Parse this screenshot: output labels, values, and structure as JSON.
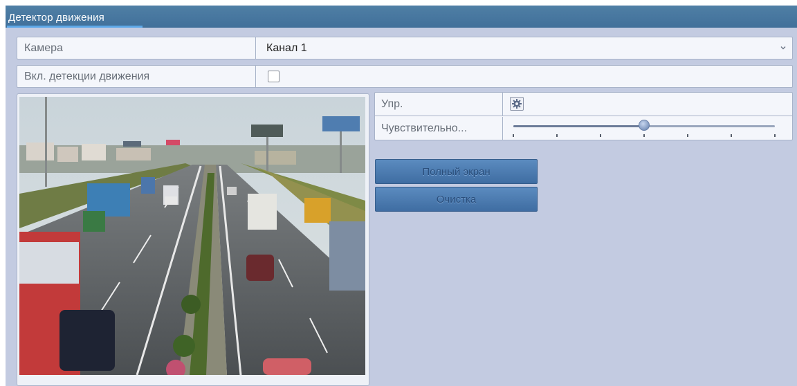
{
  "window": {
    "title": "Детектор движения"
  },
  "form": {
    "camera_label": "Камера",
    "camera_value": "Канал 1",
    "enable_label": "Вкл. детекции движения",
    "enable_checked": false
  },
  "controls": {
    "mode_label": "Упр.",
    "sensitivity_label": "Чувствительно...",
    "sensitivity_level": 0.5,
    "sensitivity_steps": 7
  },
  "buttons": {
    "fullscreen_label": "Полный экран",
    "clear_label": "Очистка"
  },
  "icons": {
    "chevron": "chevron-down-icon",
    "gear": "gear-icon"
  },
  "colors": {
    "title_bar": "#41709a",
    "accent_underline": "#5ea8e8",
    "button": "#4a78ac",
    "panel_bg": "#c3cbe1"
  }
}
